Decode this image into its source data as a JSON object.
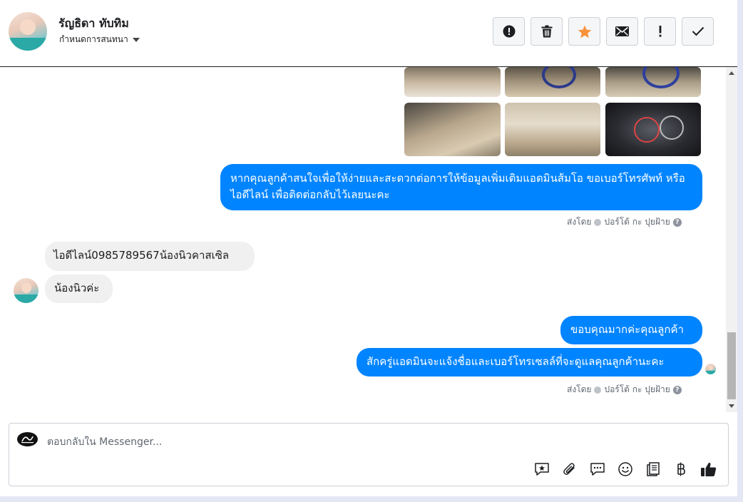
{
  "header": {
    "contact_name": "รัญธิดา ทับทิม",
    "assign_label": "กำหนดการสนทนา",
    "actions": [
      {
        "name": "spam-button",
        "icon": "alert-circle-icon"
      },
      {
        "name": "delete-button",
        "icon": "trash-icon"
      },
      {
        "name": "star-button",
        "icon": "star-icon"
      },
      {
        "name": "mark-unread-button",
        "icon": "envelope-icon"
      },
      {
        "name": "important-button",
        "icon": "exclamation-icon"
      },
      {
        "name": "done-button",
        "icon": "checkmark-icon"
      }
    ]
  },
  "messages": {
    "page_msg_1": "หากคุณลูกค้าสนใจเพื่อให้ง่ายและสะดวกต่อการให้ข้อมูลเพิ่มเติมแอดมินส้มโอ ขอเบอร์โทรศัพท์ หรือ ไอดีไลน์ เพื่อติดต่อกลับไว้เลยนะคะ",
    "user_msg_1": "ไอดีไลน์0985789567น้องนิวคาสเซิล",
    "user_msg_2": "น้องนิวค่ะ",
    "page_msg_2": "ขอบคุณมากค่ะคุณลูกค้า",
    "page_msg_3": "สักครู่แอดมินจะแจ้งชื่อและเบอร์โทรเซลล์ที่จะดูแลคุณลูกค้านะคะ",
    "sent_by_label": "ส่งโดย",
    "sender_name": "ปอร์โต้ กะ ปุยฝ้าย"
  },
  "composer": {
    "placeholder": "ตอบกลับใน Messenger...",
    "tools": [
      "saved-reply-icon",
      "attachment-icon",
      "chat-bubble-icon",
      "emoji-icon",
      "catalog-icon",
      "baht-currency-icon",
      "thumbs-up-icon"
    ]
  },
  "colors": {
    "outgoing_bubble": "#0084ff",
    "incoming_bubble": "#f1f0f0",
    "star": "#f7923b"
  }
}
